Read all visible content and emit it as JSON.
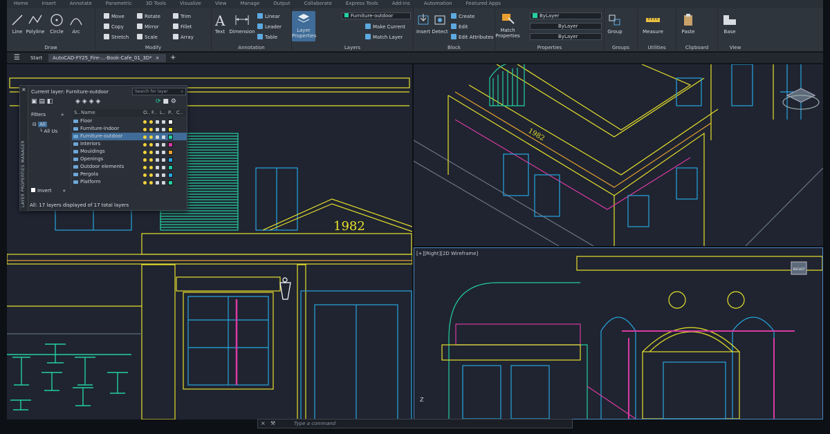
{
  "menu_tabs": [
    "Home",
    "Insert",
    "Annotate",
    "Parametric",
    "3D Tools",
    "Visualize",
    "View",
    "Manage",
    "Output",
    "Collaborate",
    "Express Tools",
    "Add-ins",
    "Automation",
    "Featured Apps"
  ],
  "ribbon": {
    "draw": {
      "label": "Draw",
      "tools": [
        "Line",
        "Polyline",
        "Circle",
        "Arc"
      ]
    },
    "modify": {
      "label": "Modify",
      "rows": [
        [
          "Move",
          "Rotate",
          "Trim"
        ],
        [
          "Copy",
          "Mirror",
          "Fillet"
        ],
        [
          "Stretch",
          "Scale",
          "Array"
        ]
      ]
    },
    "annotation": {
      "label": "Annotation",
      "tools": [
        "Text",
        "Dimension"
      ],
      "rows": [
        "Linear",
        "Leader",
        "Table"
      ]
    },
    "layers": {
      "label": "Layers",
      "tool": "Layer Properties",
      "current_layer": "Furniture-outdoor",
      "rows": [
        "Make Current",
        "Match Layer"
      ]
    },
    "block": {
      "label": "Block",
      "tools": [
        "Insert",
        "Detect"
      ],
      "rows": [
        "Create",
        "Edit",
        "Edit Attributes"
      ]
    },
    "properties": {
      "label": "Properties",
      "tool": "Match Properties",
      "combos": [
        "ByLayer",
        "ByLayer",
        "ByLayer"
      ]
    },
    "groups": {
      "label": "Groups",
      "tool": "Group"
    },
    "utilities": {
      "label": "Utilities",
      "tool": "Measure"
    },
    "clipboard": {
      "label": "Clipboard",
      "tool": "Paste"
    },
    "view": {
      "label": "View",
      "tool": "Base"
    }
  },
  "file_tabs": {
    "start": "Start",
    "active": "AutoCAD-FY25_Fire-...-Book-Cafe_01_3D*",
    "add": "+"
  },
  "layer_palette": {
    "side_title": "LAYER PROPERTIES MANAGER",
    "current": "Current layer: Furniture-outdoor",
    "search_placeholder": "Search for layer",
    "filters_label": "Filters",
    "tree": [
      "All",
      "All Us"
    ],
    "invert_label": "Invert",
    "columns": [
      "S..",
      "Name",
      "O..",
      "F..",
      "L..",
      "P..",
      "C.."
    ],
    "layers": [
      {
        "name": "Floor",
        "color": "#ffffff"
      },
      {
        "name": "Furniture-indoor",
        "color": "#e8e02c"
      },
      {
        "name": "Furniture-outdoor",
        "color": "#25d0a0",
        "selected": true
      },
      {
        "name": "Interiors",
        "color": "#d93aa3"
      },
      {
        "name": "Mouldings",
        "color": "#e8a030"
      },
      {
        "name": "Openings",
        "color": "#27a6e0"
      },
      {
        "name": "Outdoor elements",
        "color": "#20c8a0"
      },
      {
        "name": "Pergola",
        "color": "#27a6e0"
      },
      {
        "name": "Platform",
        "color": "#25d0a0"
      }
    ],
    "status": "All: 17 layers displayed of 17 total layers"
  },
  "viewports": {
    "right_label": "[+][Right][2D Wireframe]",
    "sign_text": "1982",
    "viewcube_label": "RIGHT"
  },
  "command_line": {
    "placeholder": "Type a command"
  },
  "axis_label": "Z"
}
